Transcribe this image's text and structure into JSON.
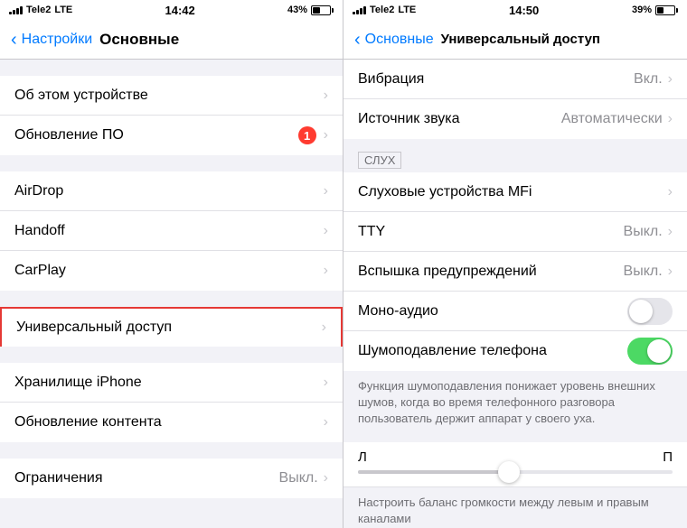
{
  "left": {
    "status": {
      "carrier": "Tele2",
      "network": "LTE",
      "time": "14:42",
      "battery_pct": 43
    },
    "nav": {
      "back_label": "Настройки",
      "title": "Основные"
    },
    "cells": [
      {
        "id": "about",
        "label": "Об этом устройстве",
        "value": "",
        "badge": ""
      },
      {
        "id": "update",
        "label": "Обновление ПО",
        "value": "",
        "badge": "1"
      },
      {
        "id": "airdrop",
        "label": "AirDrop",
        "value": "",
        "badge": ""
      },
      {
        "id": "handoff",
        "label": "Handoff",
        "value": "",
        "badge": ""
      },
      {
        "id": "carplay",
        "label": "CarPlay",
        "value": "",
        "badge": ""
      },
      {
        "id": "accessibility",
        "label": "Универсальный доступ",
        "value": "",
        "badge": "",
        "highlighted": true
      },
      {
        "id": "storage",
        "label": "Хранилище iPhone",
        "value": "",
        "badge": ""
      },
      {
        "id": "content-update",
        "label": "Обновление контента",
        "value": "",
        "badge": ""
      },
      {
        "id": "restrictions",
        "label": "Ограничения",
        "value": "Выкл.",
        "badge": ""
      }
    ]
  },
  "right": {
    "status": {
      "carrier": "Tele2",
      "network": "LTE",
      "time": "14:50",
      "battery_pct": 39
    },
    "nav": {
      "back_label": "Основные",
      "title": "Универсальный доступ"
    },
    "top_cells": [
      {
        "id": "vibration",
        "label": "Вибрация",
        "value": "Вкл."
      },
      {
        "id": "sound-source",
        "label": "Источник звука",
        "value": "Автоматически"
      }
    ],
    "section_header": "СЛУХ",
    "hearing_cells": [
      {
        "id": "mfi",
        "label": "Слуховые устройства MFi",
        "value": ""
      },
      {
        "id": "tty",
        "label": "TTY",
        "value": "Выкл."
      },
      {
        "id": "flash",
        "label": "Вспышка предупреждений",
        "value": "Выкл."
      },
      {
        "id": "mono",
        "label": "Моно-аудио",
        "value": "",
        "toggle": "off"
      },
      {
        "id": "noise",
        "label": "Шумоподавление телефона",
        "value": "",
        "toggle": "on"
      }
    ],
    "noise_description": "Функция шумоподавления понижает уровень внешних шумов, когда во время телефонного разговора пользователь держит аппарат у своего уха.",
    "slider": {
      "left_label": "Л",
      "right_label": "П",
      "value": 50
    },
    "slider_description": "Настроить баланс громкости между левым и правым каналами"
  }
}
